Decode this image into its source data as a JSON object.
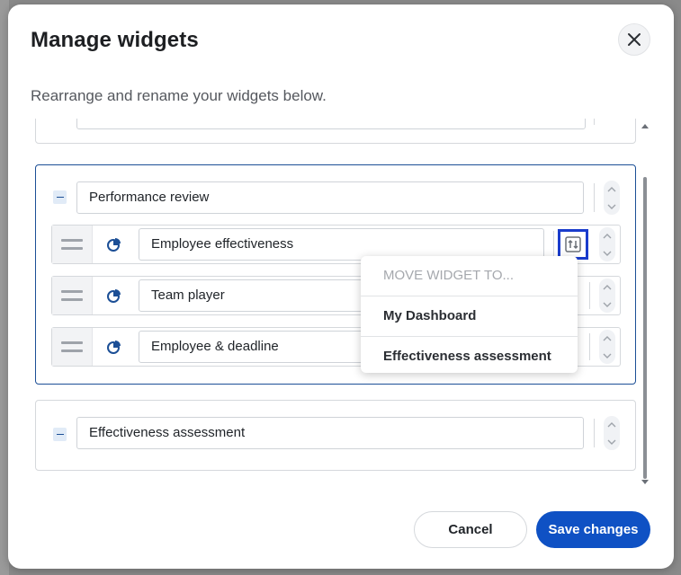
{
  "dialog": {
    "title": "Manage widgets",
    "subtitle": "Rearrange and rename your widgets below."
  },
  "groups": [
    {
      "name": "",
      "collapsed_partially_visible": true
    },
    {
      "name": "Performance review",
      "widgets": [
        {
          "name": "Employee effectiveness",
          "icon": "pie-chart-icon"
        },
        {
          "name": "Team player",
          "icon": "pie-chart-icon"
        },
        {
          "name": "Employee & deadline",
          "icon": "pie-chart-icon"
        }
      ]
    },
    {
      "name": "Effectiveness assessment",
      "widgets": []
    }
  ],
  "move_menu": {
    "header": "MOVE WIDGET TO...",
    "options": [
      "My Dashboard",
      "Effectiveness assessment"
    ]
  },
  "footer": {
    "cancel_label": "Cancel",
    "save_label": "Save changes"
  },
  "colors": {
    "primary": "#0f51c4",
    "active_border": "#1c4f96",
    "highlight": "#1a3ccc"
  }
}
